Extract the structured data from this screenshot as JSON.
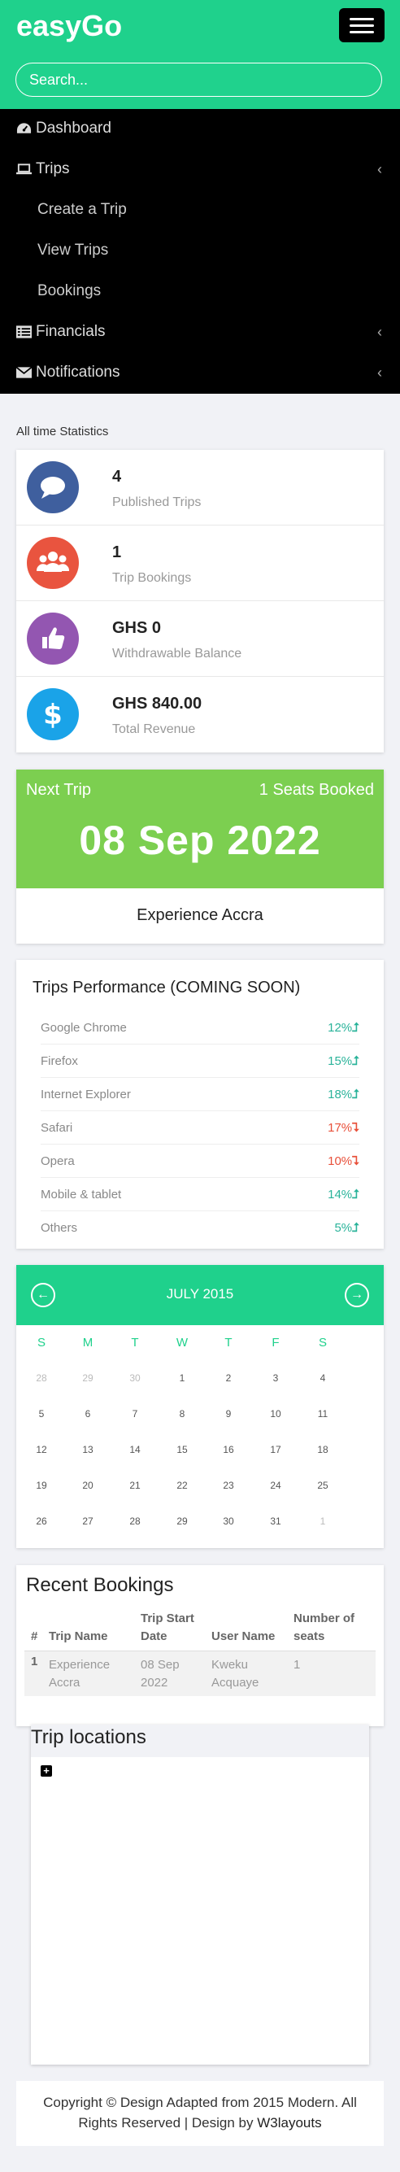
{
  "header": {
    "logo": "easyGo",
    "search_placeholder": "Search..."
  },
  "nav": {
    "items": [
      {
        "label": "Dashboard",
        "icon": "dashboard-icon"
      },
      {
        "label": "Trips",
        "icon": "laptop-icon"
      },
      {
        "label": "Financials",
        "icon": "list-icon"
      },
      {
        "label": "Notifications",
        "icon": "envelope-icon"
      }
    ],
    "trips_sub": [
      "Create a Trip",
      "View Trips",
      "Bookings"
    ]
  },
  "stats": {
    "title": "All time Statistics",
    "items": [
      {
        "value": "4",
        "label": "Published Trips",
        "icon": "chat-icon",
        "color": "#3f5f9e"
      },
      {
        "value": "1",
        "label": "Trip Bookings",
        "icon": "users-icon",
        "color": "#e9543f"
      },
      {
        "value": "GHS 0",
        "label": "Withdrawable Balance",
        "icon": "thumbs-up-icon",
        "color": "#9356b1"
      },
      {
        "value": "GHS 840.00",
        "label": "Total Revenue",
        "icon": "dollar-icon",
        "color": "#1aa3e8"
      }
    ]
  },
  "next_trip": {
    "heading": "Next Trip",
    "seats": "1 Seats Booked",
    "date": "08 Sep 2022",
    "name": "Experience Accra"
  },
  "performance": {
    "title": "Trips Performance (COMING SOON)",
    "rows": [
      {
        "name": "Google Chrome",
        "value": "12%",
        "trend": "up"
      },
      {
        "name": "Firefox",
        "value": "15%",
        "trend": "up"
      },
      {
        "name": "Internet Explorer",
        "value": "18%",
        "trend": "up"
      },
      {
        "name": "Safari",
        "value": "17%",
        "trend": "down"
      },
      {
        "name": "Opera",
        "value": "10%",
        "trend": "down"
      },
      {
        "name": "Mobile & tablet",
        "value": "14%",
        "trend": "up"
      },
      {
        "name": "Others",
        "value": "5%",
        "trend": "up"
      }
    ]
  },
  "calendar": {
    "month": "JULY 2015",
    "dow": [
      "S",
      "M",
      "T",
      "W",
      "T",
      "F",
      "S"
    ],
    "weeks": [
      [
        "28",
        "29",
        "30",
        "1",
        "2",
        "3",
        "4"
      ],
      [
        "5",
        "6",
        "7",
        "8",
        "9",
        "10",
        "11"
      ],
      [
        "12",
        "13",
        "14",
        "15",
        "16",
        "17",
        "18"
      ],
      [
        "19",
        "20",
        "21",
        "22",
        "23",
        "24",
        "25"
      ],
      [
        "26",
        "27",
        "28",
        "29",
        "30",
        "31",
        "1"
      ]
    ]
  },
  "recent_bookings": {
    "title": "Recent Bookings",
    "headers": [
      "#",
      "Trip Name",
      "Trip Start Date",
      "User Name",
      "Number of seats"
    ],
    "rows": [
      {
        "num": "1",
        "trip": "Experience Accra",
        "date": "08 Sep 2022",
        "user": "Kweku Acquaye",
        "seats": "1"
      }
    ]
  },
  "trip_locations": {
    "title": "Trip locations"
  },
  "footer": {
    "line1": "Copyright © Design Adapted from 2015 Modern. All",
    "line2_prefix": "Rights Reserved | Design by ",
    "link": "W3layouts"
  }
}
